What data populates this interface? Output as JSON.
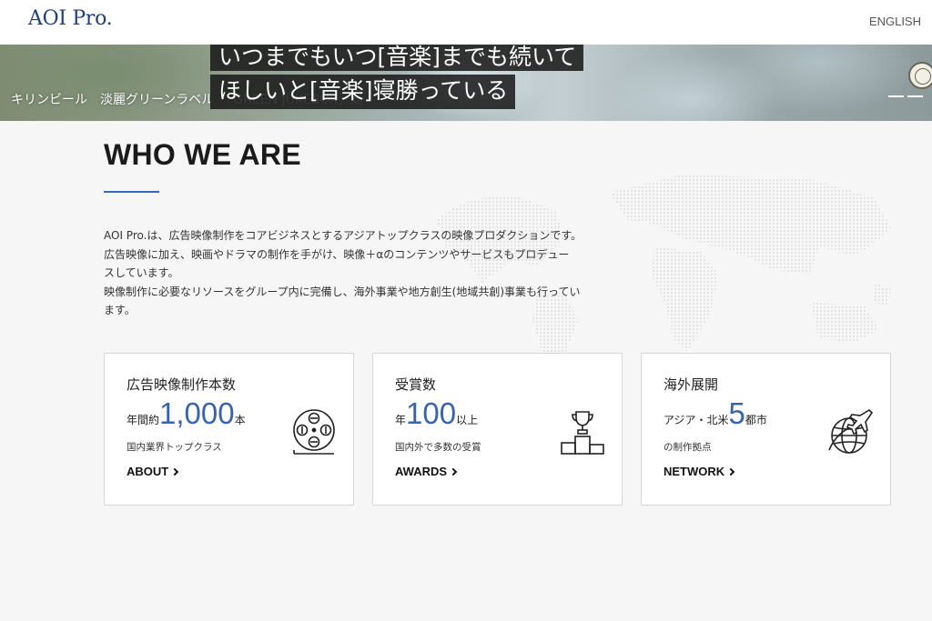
{
  "header": {
    "logo": "AOI Pro.",
    "language_link": "ENGLISH"
  },
  "hero": {
    "caption": "キリンビール　淡麗グリーンラベル　「GREEN JUKEBOX」篇",
    "subtitle_line1": "いつまでもいつ[音楽]までも続いて",
    "subtitle_line2": "ほしいと[音楽]寝勝っている"
  },
  "about": {
    "title": "WHO WE ARE",
    "lines": [
      "AOI Pro.は、広告映像制作をコアビジネスとするアジアトップクラスの映像プロダクションです。",
      "広告映像に加え、映画やドラマの制作を手がけ、映像＋αのコンテンツやサービスもプロデュー",
      "スしています。",
      "映像制作に必要なリソースをグループ内に完備し、海外事業や地方創生(地域共創)事業も行ってい",
      "ます。"
    ]
  },
  "cards": [
    {
      "title": "広告映像制作本数",
      "prefix": "年間約",
      "number": "1,000",
      "suffix": "本",
      "sub": "国内業界トップクラス",
      "link": "ABOUT",
      "icon": "film-reel-icon"
    },
    {
      "title": "受賞数",
      "prefix": "年",
      "number": "100",
      "suffix": "以上",
      "sub": "国内外で多数の受賞",
      "link": "AWARDS",
      "icon": "trophy-podium-icon"
    },
    {
      "title": "海外展開",
      "prefix": "アジア・北米",
      "number": "5",
      "suffix": "都市",
      "sub": "の制作拠点",
      "link": "NETWORK",
      "icon": "globe-airplane-icon"
    }
  ],
  "colors": {
    "brand": "#1f3f7a",
    "accent": "#3a63ad",
    "background": "#f6f6f6"
  }
}
